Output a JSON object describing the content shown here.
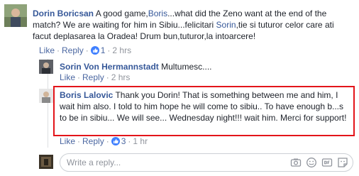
{
  "comments": [
    {
      "author": "Dorin Boricsan",
      "text_before": " A good game,",
      "mention_1": "Boris",
      "text_middle": "...what did the Zeno want at the end of the match? We are waiting for him in Sibiu...felicitari ",
      "mention_2": "Sorin",
      "text_after": ",tie si tuturor celor care ati facut deplasarea la Oradea! Drum bun,tuturor,la intoarcere!",
      "like": "Like",
      "reply": "Reply",
      "like_count": "1",
      "time": "2 hrs"
    },
    {
      "author": "Sorin Von Hermannstadt",
      "text": " Multumesc....",
      "like": "Like",
      "reply": "Reply",
      "time": "2 hrs"
    },
    {
      "author": "Boris Lalovic",
      "text": " Thank you Dorin! That is something between me and him, I wait him also. I told to him hope he will come to sibiu.. To have enough b...s to be in sibiu... We will see... Wednesday night!!! wait him. Merci for support!",
      "like": "Like",
      "reply": "Reply",
      "like_count": "3",
      "time": "1 hr"
    }
  ],
  "reply_box": {
    "placeholder": "Write a reply..."
  },
  "colors": {
    "link": "#365899",
    "highlight_border": "#e3141a",
    "like_badge": "#4080ff"
  },
  "icons": [
    "camera-icon",
    "emoji-icon",
    "gif-icon",
    "sticker-icon",
    "like-thumb-icon"
  ]
}
